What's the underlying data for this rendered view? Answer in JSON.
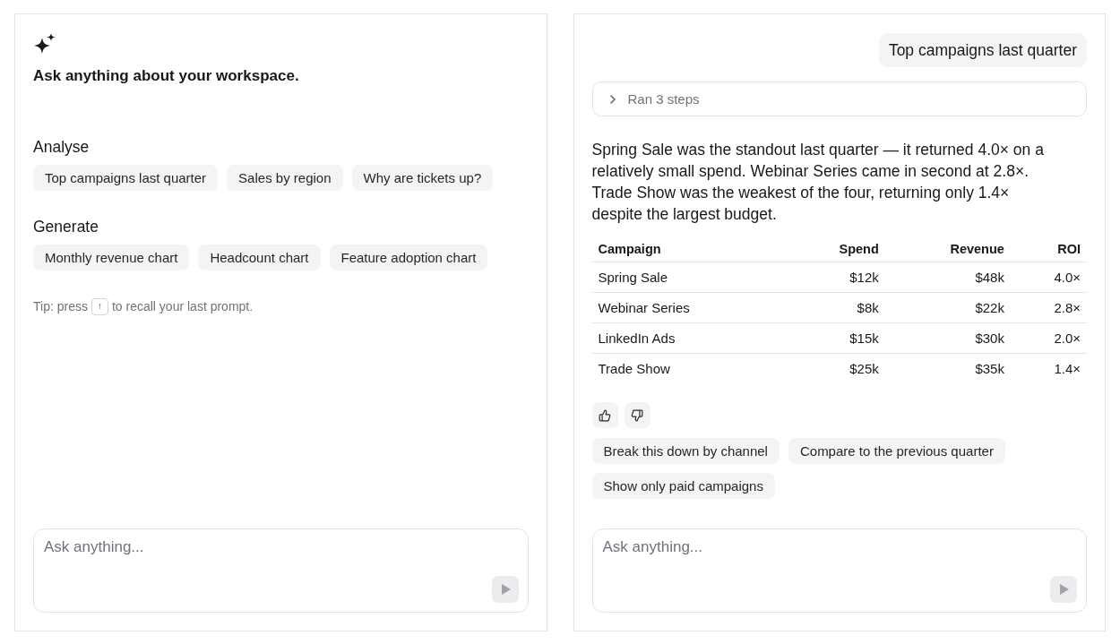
{
  "welcome_panel": {
    "heading": "Ask anything about your workspace.",
    "sections": [
      {
        "title": "Analyse",
        "suggestions": [
          "Top campaigns last quarter",
          "Sales by region",
          "Why are tickets up?"
        ]
      },
      {
        "title": "Generate",
        "suggestions": [
          "Monthly revenue chart",
          "Headcount chart",
          "Feature adoption chart"
        ]
      }
    ],
    "tip": {
      "before": "Tip: press",
      "key": "↑",
      "after": "to recall your last prompt."
    },
    "composer": {
      "placeholder": "Ask anything...",
      "send_disabled": true
    }
  },
  "chat_panel": {
    "user_message": "Top campaigns last quarter",
    "steps": {
      "label": "Ran 3 steps",
      "expanded": false
    },
    "answer": "Spring Sale was the standout last quarter — it returned 4.0× on a relatively small spend. Webinar Series came in second at 2.8×. Trade Show was the weakest of the four, returning only 1.4× despite the largest budget.",
    "table": {
      "columns": [
        "Campaign",
        "Spend",
        "Revenue",
        "ROI"
      ],
      "rows": [
        [
          "Spring Sale",
          "$12k",
          "$48k",
          "4.0×"
        ],
        [
          "Webinar Series",
          "$8k",
          "$22k",
          "2.8×"
        ],
        [
          "LinkedIn Ads",
          "$15k",
          "$30k",
          "2.0×"
        ],
        [
          "Trade Show",
          "$25k",
          "$35k",
          "1.4×"
        ]
      ]
    },
    "follow_ups": [
      "Break this down by channel",
      "Compare to the previous quarter",
      "Show only paid campaigns"
    ],
    "composer": {
      "placeholder": "Ask anything...",
      "send_disabled": true
    }
  }
}
